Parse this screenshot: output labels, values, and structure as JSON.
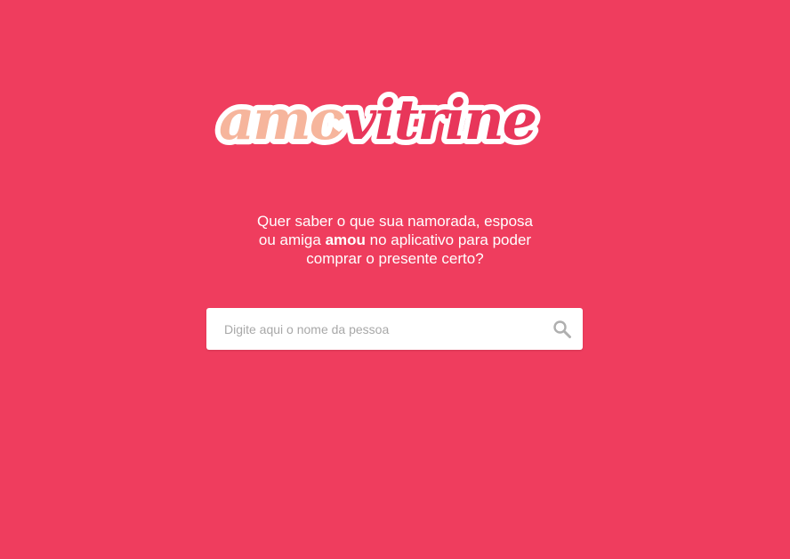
{
  "brand": {
    "name_part1": "amo",
    "name_part2": "vitrine",
    "colors": {
      "background": "#EF3D5E",
      "logo_peach": "#F6B59C",
      "logo_pink": "#E8365A",
      "logo_outline": "#FFFFFF"
    }
  },
  "hero": {
    "line1": "Quer saber o que sua namorada, esposa",
    "line2_before": "ou amiga ",
    "line2_bold": "amou",
    "line2_after": " no aplicativo para poder",
    "line3": "comprar o presente certo?"
  },
  "search": {
    "placeholder": "Digite aqui o nome da pessoa",
    "value": "",
    "icon": "search-icon"
  }
}
